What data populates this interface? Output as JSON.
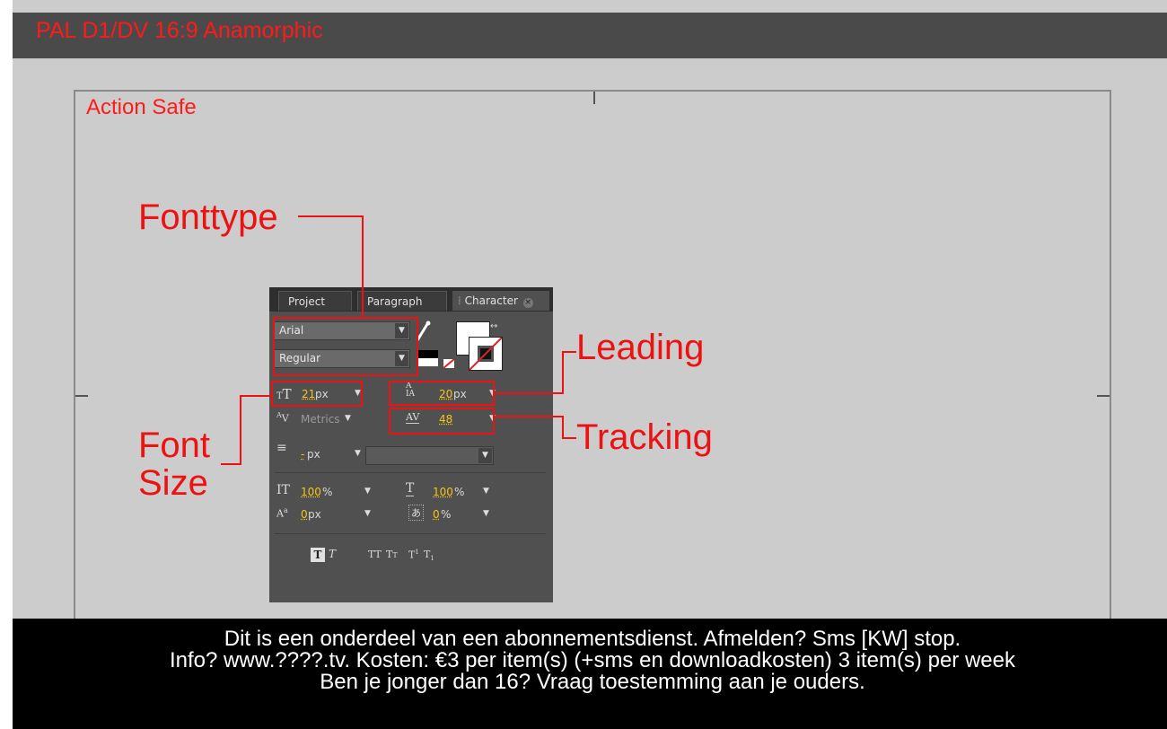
{
  "composition": {
    "title": "PAL D1/DV 16:9 Anamorphic",
    "safe_zone_label": "Action Safe"
  },
  "caption": {
    "lines": [
      "Dit is een onderdeel van een abonnementsdienst. Afmelden? Sms [KW] stop.",
      "Info? www.????.tv. Kosten: €3 per item(s) (+sms en downloadkosten) 3 item(s) per week",
      "Ben je jonger dan 16? Vraag toestemming aan je ouders."
    ]
  },
  "callouts": {
    "fonttype": "Fonttype",
    "leading": "Leading",
    "tracking": "Tracking",
    "font_size_line1": "Font",
    "font_size_line2": "Size"
  },
  "panel": {
    "tabs": [
      "Project",
      "Paragraph",
      "Character"
    ],
    "active_tab": "Character",
    "font_family": "Arial",
    "font_style": "Regular",
    "font_size": {
      "value": "21",
      "unit": "px"
    },
    "leading": {
      "value": "20",
      "unit": "px"
    },
    "kerning": {
      "value": "Metrics"
    },
    "tracking": {
      "value": "48"
    },
    "stroke_width": {
      "value": "-",
      "unit": "px"
    },
    "vertical_scale": {
      "value": "100",
      "unit": "%"
    },
    "horizontal_scale": {
      "value": "100",
      "unit": "%"
    },
    "baseline_shift": {
      "value": "0",
      "unit": "px"
    },
    "tsume": {
      "value": "0",
      "unit": "%"
    }
  },
  "colors": {
    "annotation": "#ee1111",
    "value_highlight": "#f5c518",
    "panel_bg": "#505050"
  }
}
